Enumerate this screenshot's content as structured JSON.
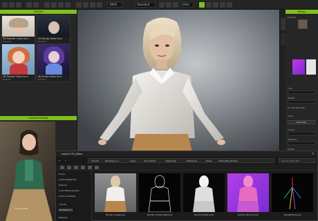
{
  "toolbar": {
    "zoom": "100%",
    "mode": "Standard",
    "camera": "View",
    "scene_label": "Scene"
  },
  "left_panel": {
    "header": "Content",
    "preview_header": "Content Preview",
    "cards": [
      {
        "title": "3D Realistic Video Guru",
        "sub": "Realistic"
      },
      {
        "title": "3D Manga Video Guru",
        "sub": "Realistic"
      },
      {
        "title": "3D Stylized Video Guru",
        "sub": "Realistic"
      },
      {
        "title": "3D Anime Video Guru",
        "sub": "Realistic"
      }
    ],
    "preview_caption": "Girl_Woman",
    "footer_label": "Gown Outfit"
  },
  "right_panel": {
    "header": "Motion",
    "tab": "Preview",
    "rows": [
      "Flow",
      "Weight",
      "Prompt Strength",
      "Seed",
      "Create",
      "Negative",
      "Stylize"
    ],
    "button": "Generate"
  },
  "explorer": {
    "title": "explore 101_cBase",
    "path": [
      "This PC",
      "Windows (C:)",
      "Users",
      "Documents",
      "Reallusion",
      "Reference",
      "Poses",
      "2024_WM_SD(cfw)"
    ],
    "search": "Search 2024_WM",
    "sidebar": [
      "Home",
      "Videos Respirator",
      "Pictures",
      "Lookd Businessidae",
      "Lands Animated",
      "This PC",
      "Windows (C:)",
      "Network"
    ],
    "files": [
      {
        "name": "Render Image.png"
      },
      {
        "name": "Render Image Edge.png"
      },
      {
        "name": "Render Depth.png"
      },
      {
        "name": "Render Normal.png"
      },
      {
        "name": "RenderPose.png"
      }
    ]
  },
  "colors": {
    "accent": "#7ec11f",
    "panel": "#262626",
    "background": "#1b1b1b"
  }
}
